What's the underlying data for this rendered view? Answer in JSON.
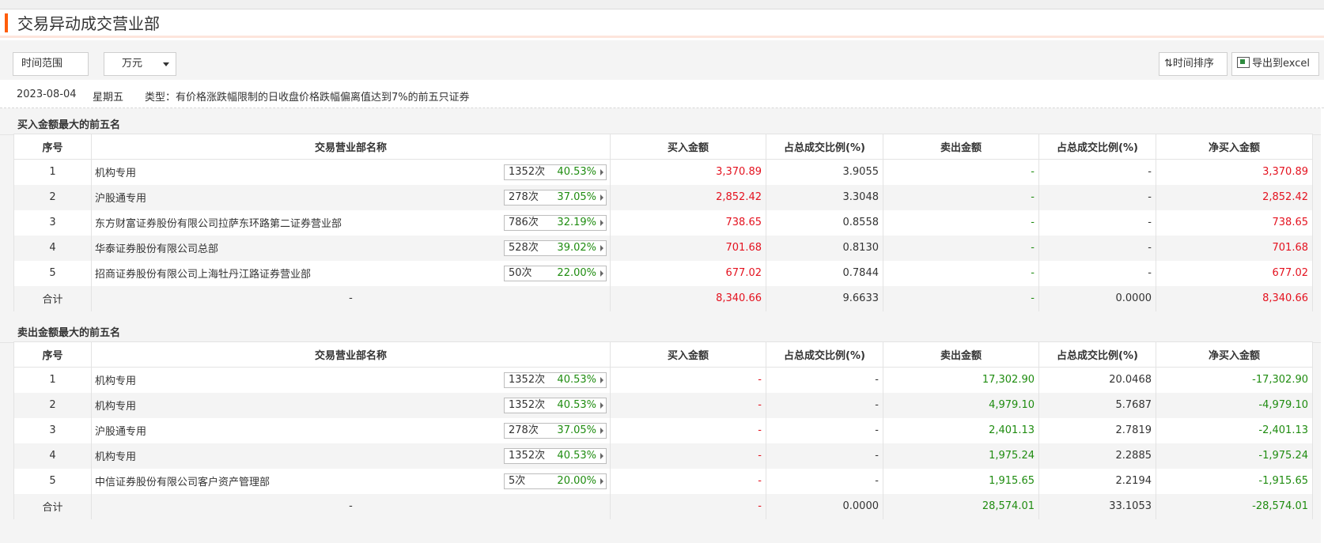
{
  "page": {
    "title": "交易异动成交营业部"
  },
  "toolbar": {
    "time_range_label": "时间范围",
    "unit_value": "万元",
    "sort_label": "时间排序",
    "export_label": "导出到excel"
  },
  "info": {
    "date": "2023-08-04",
    "weekday": "星期五",
    "type": "类型：有价格涨跌幅限制的日收盘价格跌幅偏离值达到7%的前五只证券"
  },
  "columns": [
    "序号",
    "交易营业部名称",
    "买入金额",
    "占总成交比例(%)",
    "卖出金额",
    "占总成交比例(%)",
    "净买入金额"
  ],
  "buy_section": {
    "title": "买入金额最大的前五名",
    "rows": [
      {
        "idx": "1",
        "name": "机构专用",
        "count": "1352次",
        "pct": "40.53%",
        "buy": "3,370.89",
        "buy_ratio": "3.9055",
        "sell": "-",
        "sell_ratio": "-",
        "net": "3,370.89"
      },
      {
        "idx": "2",
        "name": "沪股通专用",
        "count": "278次",
        "pct": "37.05%",
        "buy": "2,852.42",
        "buy_ratio": "3.3048",
        "sell": "-",
        "sell_ratio": "-",
        "net": "2,852.42"
      },
      {
        "idx": "3",
        "name": "东方财富证券股份有限公司拉萨东环路第二证券营业部",
        "count": "786次",
        "pct": "32.19%",
        "buy": "738.65",
        "buy_ratio": "0.8558",
        "sell": "-",
        "sell_ratio": "-",
        "net": "738.65"
      },
      {
        "idx": "4",
        "name": "华泰证券股份有限公司总部",
        "count": "528次",
        "pct": "39.02%",
        "buy": "701.68",
        "buy_ratio": "0.8130",
        "sell": "-",
        "sell_ratio": "-",
        "net": "701.68"
      },
      {
        "idx": "5",
        "name": "招商证券股份有限公司上海牡丹江路证券营业部",
        "count": "50次",
        "pct": "22.00%",
        "buy": "677.02",
        "buy_ratio": "0.7844",
        "sell": "-",
        "sell_ratio": "-",
        "net": "677.02"
      }
    ],
    "total": {
      "label": "合计",
      "name": "-",
      "buy": "8,340.66",
      "buy_ratio": "9.6633",
      "sell": "-",
      "sell_ratio": "0.0000",
      "net": "8,340.66"
    }
  },
  "sell_section": {
    "title": "卖出金额最大的前五名",
    "rows": [
      {
        "idx": "1",
        "name": "机构专用",
        "count": "1352次",
        "pct": "40.53%",
        "buy": "-",
        "buy_ratio": "-",
        "sell": "17,302.90",
        "sell_ratio": "20.0468",
        "net": "-17,302.90"
      },
      {
        "idx": "2",
        "name": "机构专用",
        "count": "1352次",
        "pct": "40.53%",
        "buy": "-",
        "buy_ratio": "-",
        "sell": "4,979.10",
        "sell_ratio": "5.7687",
        "net": "-4,979.10"
      },
      {
        "idx": "3",
        "name": "沪股通专用",
        "count": "278次",
        "pct": "37.05%",
        "buy": "-",
        "buy_ratio": "-",
        "sell": "2,401.13",
        "sell_ratio": "2.7819",
        "net": "-2,401.13"
      },
      {
        "idx": "4",
        "name": "机构专用",
        "count": "1352次",
        "pct": "40.53%",
        "buy": "-",
        "buy_ratio": "-",
        "sell": "1,975.24",
        "sell_ratio": "2.2885",
        "net": "-1,975.24"
      },
      {
        "idx": "5",
        "name": "中信证券股份有限公司客户资产管理部",
        "count": "5次",
        "pct": "20.00%",
        "buy": "-",
        "buy_ratio": "-",
        "sell": "1,915.65",
        "sell_ratio": "2.2194",
        "net": "-1,915.65"
      }
    ],
    "total": {
      "label": "合计",
      "name": "-",
      "buy": "-",
      "buy_ratio": "0.0000",
      "sell": "28,574.01",
      "sell_ratio": "33.1053",
      "net": "-28,574.01"
    }
  },
  "colors": {
    "accent": "#ff5d0b",
    "up": "#e4121f",
    "down": "#1f8c10"
  }
}
